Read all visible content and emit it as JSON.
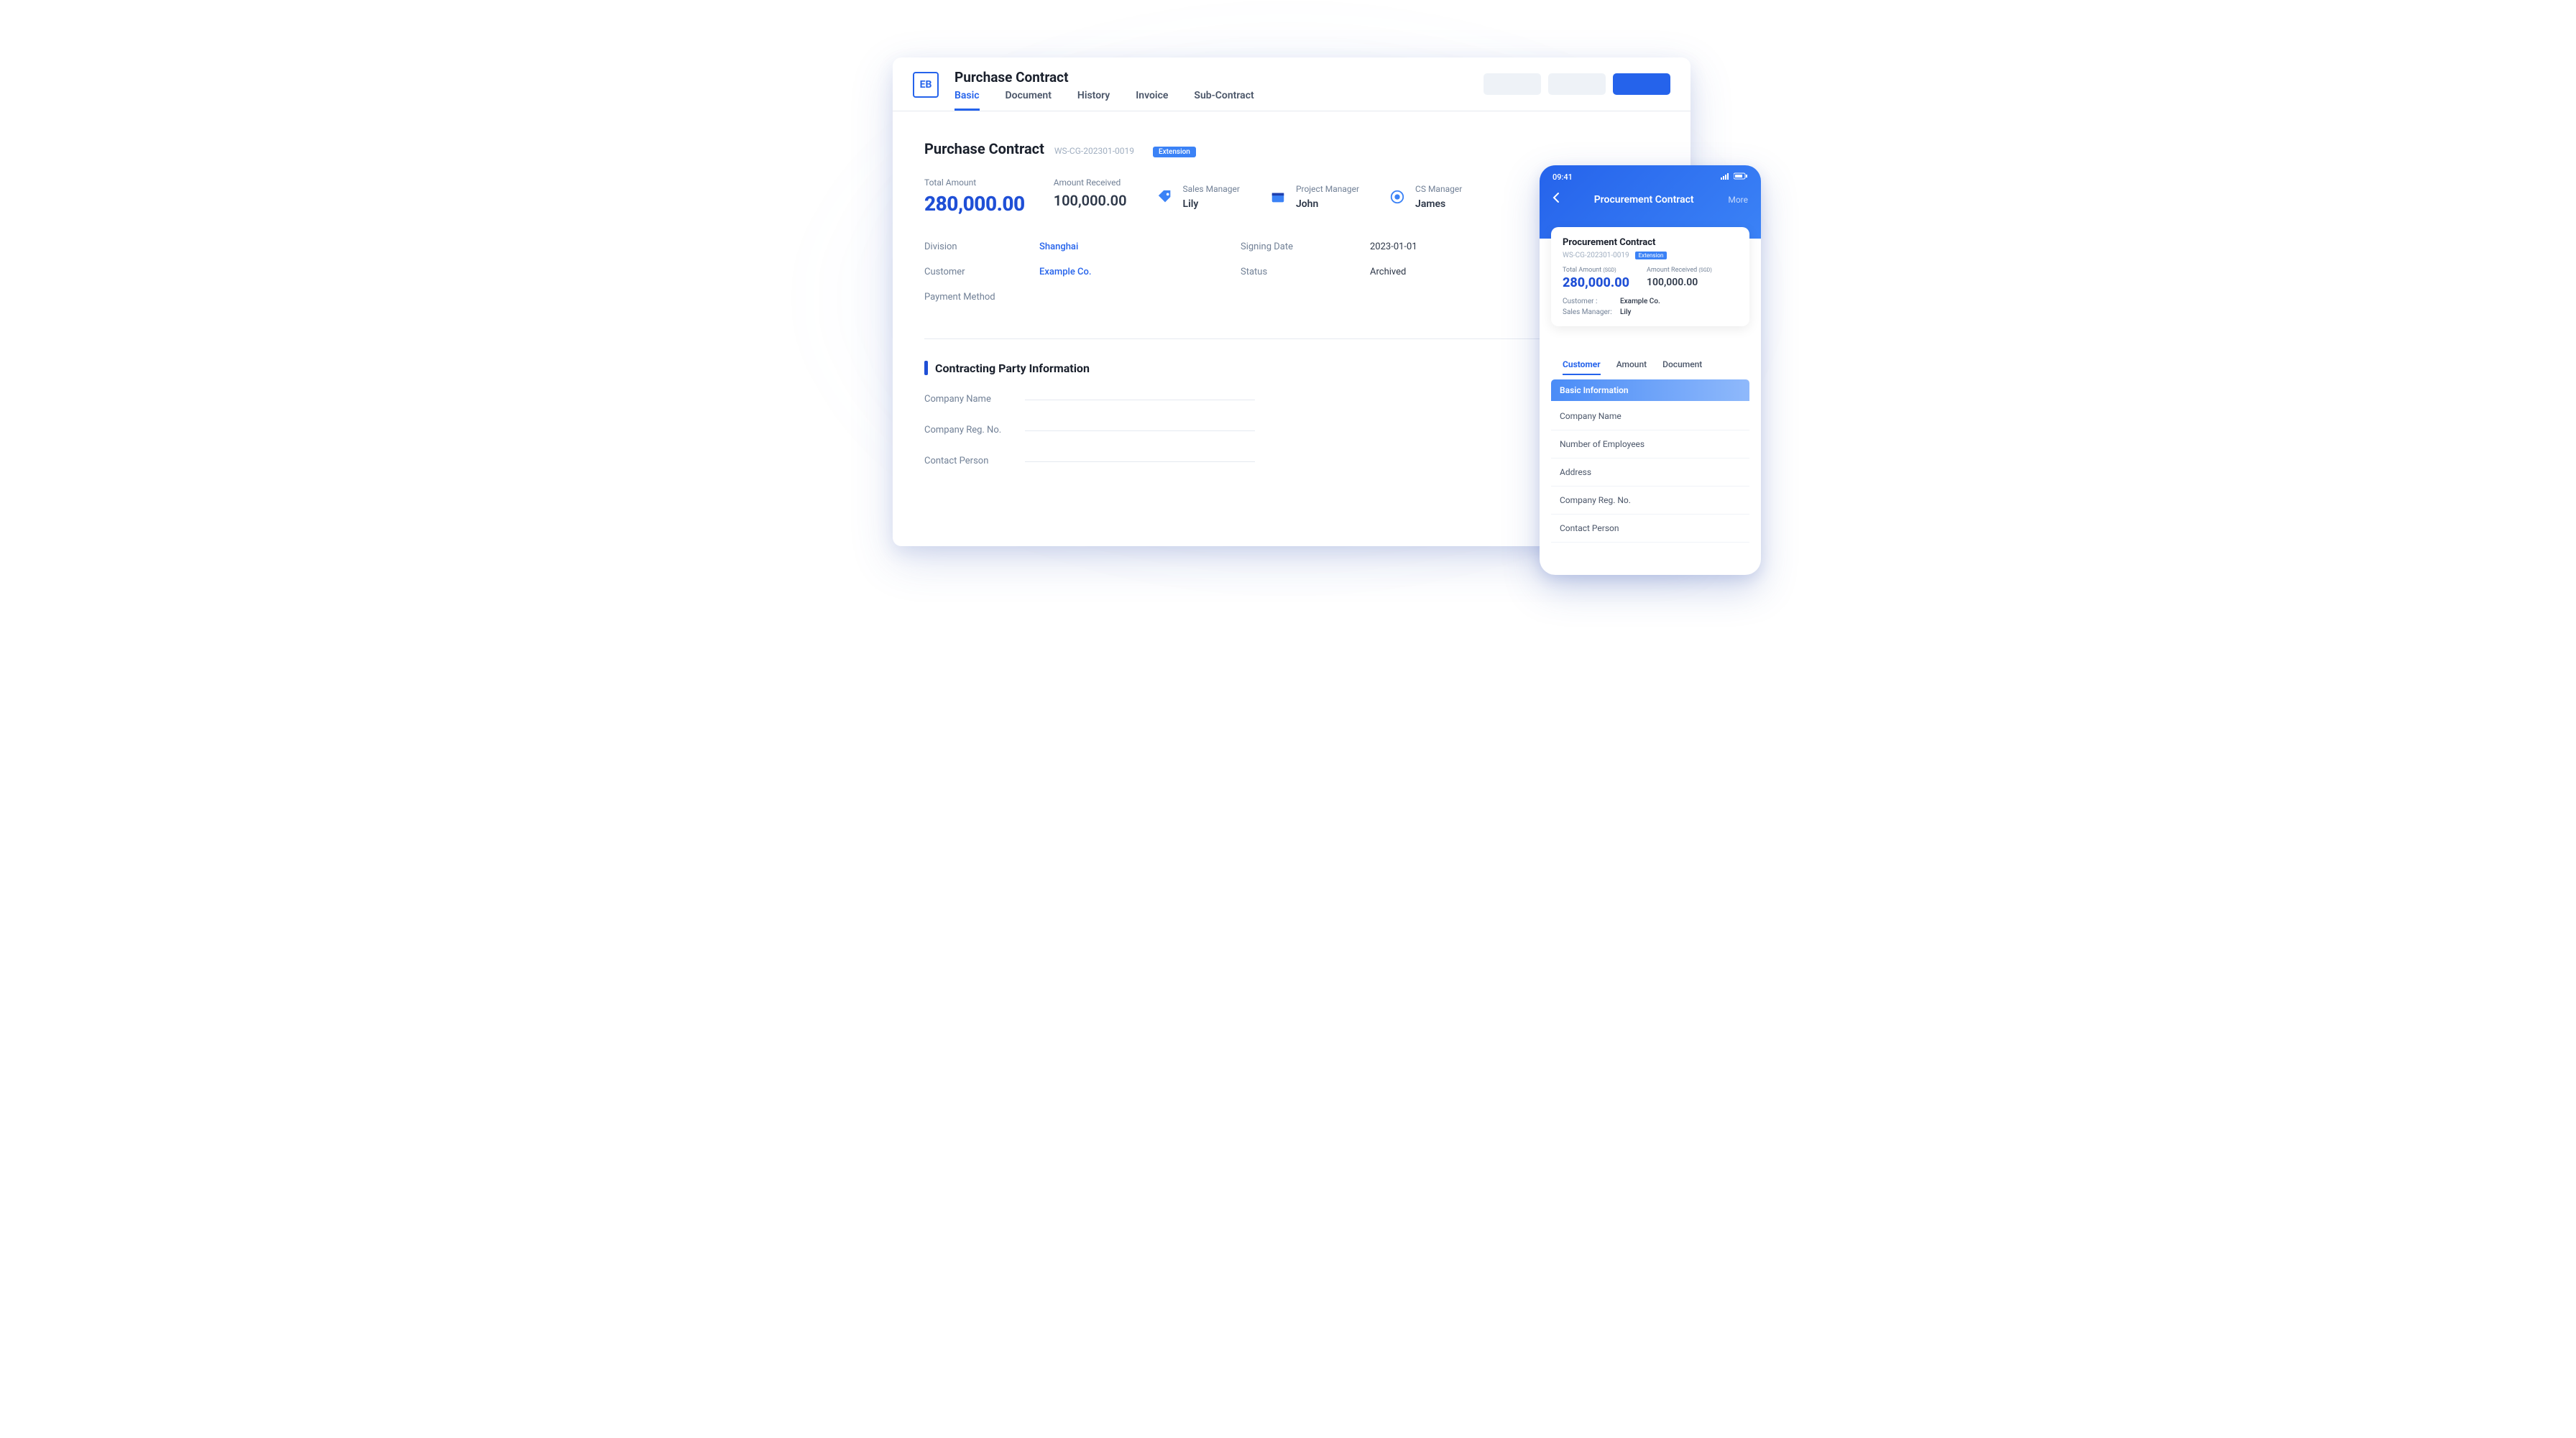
{
  "desktop": {
    "logo": "EB",
    "title": "Purchase Contract",
    "tabs": [
      "Basic",
      "Document",
      "History",
      "Invoice",
      "Sub-Contract"
    ],
    "crumb_title": "Purchase Contract",
    "crumb_sub": "WS-CG-202301-0019",
    "badge": "Extension",
    "stats": {
      "total_label": "Total Amount",
      "total_value": "280,000.00",
      "received_label": "Amount Received",
      "received_value": "100,000.00",
      "sales_label": "Sales Manager",
      "sales_value": "Lily",
      "project_label": "Project Manager",
      "project_value": "John",
      "cs_label": "CS Manager",
      "cs_value": "James"
    },
    "fields": {
      "division_l": "Division",
      "division_v": "Shanghai",
      "customer_l": "Customer",
      "customer_v": "Example Co.",
      "payment_l": "Payment Method",
      "signing_l": "Signing Date",
      "signing_v": "2023-01-01",
      "status_l": "Status",
      "status_v": "Archived"
    },
    "section_title": "Contracting Party Information",
    "form": {
      "company_name": "Company Name",
      "company_reg": "Company Reg. No.",
      "contact_person": "Contact Person"
    }
  },
  "mobile": {
    "time": "09:41",
    "nav_title": "Procurement Contract",
    "more": "More",
    "card": {
      "title": "Procurement Contract",
      "sub": "WS-CG-202301-0019",
      "badge": "Extension",
      "total_l": "Total Amount",
      "total_unit": "(SGD)",
      "total_v": "280,000.00",
      "recv_l": "Amount Received",
      "recv_unit": "(SGD)",
      "recv_v": "100,000.00",
      "customer_l": "Customer :",
      "customer_v": "Example Co.",
      "sales_l": "Sales Manager:",
      "sales_v": "Lily"
    },
    "tabs": [
      "Customer",
      "Amount",
      "Document"
    ],
    "section": "Basic Information",
    "items": [
      "Company Name",
      "Number of Employees",
      "Address",
      "Company Reg. No.",
      "Contact Person"
    ]
  }
}
